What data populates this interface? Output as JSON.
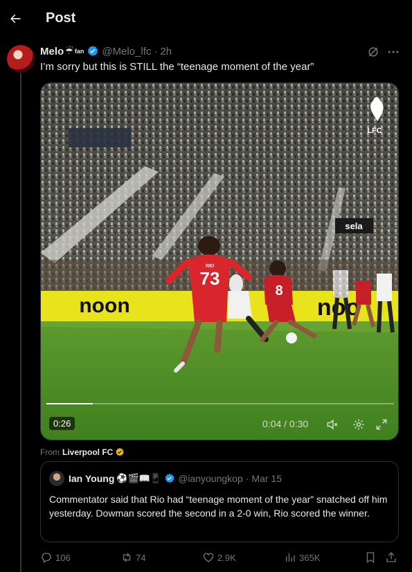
{
  "header": {
    "title": "Post"
  },
  "post": {
    "author_name": "Melo",
    "author_emoji": "☔",
    "author_fan_tag": "fan",
    "handle": "@Melo_lfc",
    "separator": "·",
    "time": "2h",
    "text": "I’m sorry but this is STILL the “teenage moment of the year”"
  },
  "video": {
    "duration_badge": "0:26",
    "timecode": "0:04 / 0:30",
    "progress_fraction": 0.133,
    "scene_texts": {
      "board_left": "noon",
      "board_right": "noo",
      "player_number_a": "73",
      "player_number_b": "8",
      "sponsor_board": "sela",
      "club_crest_text": "LFC",
      "name_on_shirt": "RIO"
    }
  },
  "from": {
    "prefix": "From",
    "source": "Liverpool FC"
  },
  "quote": {
    "author_name": "Ian Young",
    "author_emoji": "⚽🎬📖📱",
    "handle": "@ianyoungkop",
    "separator": "·",
    "date": "Mar 15",
    "text": "Commentator said that Rio had “teenage moment of the year” snatched off him yesterday. Dowman scored the second in a 2-0 win, Rio scored the winner."
  },
  "actions": {
    "replies": "106",
    "reposts": "74",
    "likes": "2.9K",
    "views": "365K"
  },
  "colors": {
    "background": "#000000",
    "text_primary": "#e7e9ea",
    "text_secondary": "#71767b",
    "verified_blue": "#1d9bf0",
    "verified_gold": "#e2b719",
    "border": "#2f3336"
  }
}
